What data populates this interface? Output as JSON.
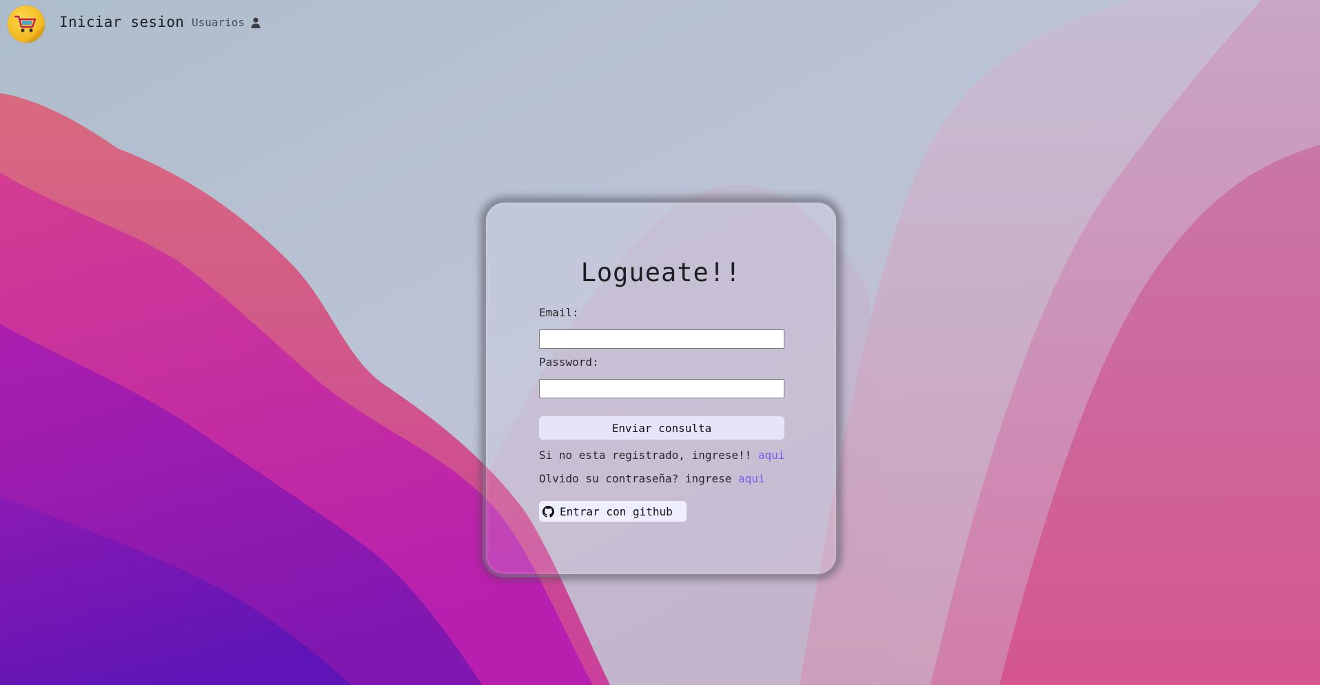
{
  "navbar": {
    "brand": "Iniciar sesion",
    "users_label": "Usuarios",
    "logo_icon": "shopping-cart-icon",
    "users_icon": "user-icon"
  },
  "login": {
    "title": "Logueate!!",
    "email_label": "Email:",
    "email_value": "",
    "password_label": "Password:",
    "password_value": "",
    "submit_label": "Enviar consulta",
    "register_text": "Si no esta registrado, ingrese!!",
    "register_link": "aqui",
    "forgot_text": "Olvido su contraseña? ingrese",
    "forgot_link": "aqui",
    "github_label": "Entrar con github",
    "github_icon": "github-icon"
  },
  "colors": {
    "link": "#7560ee",
    "button_bg": "#e6e4fb",
    "logo": "#f2b51b"
  }
}
